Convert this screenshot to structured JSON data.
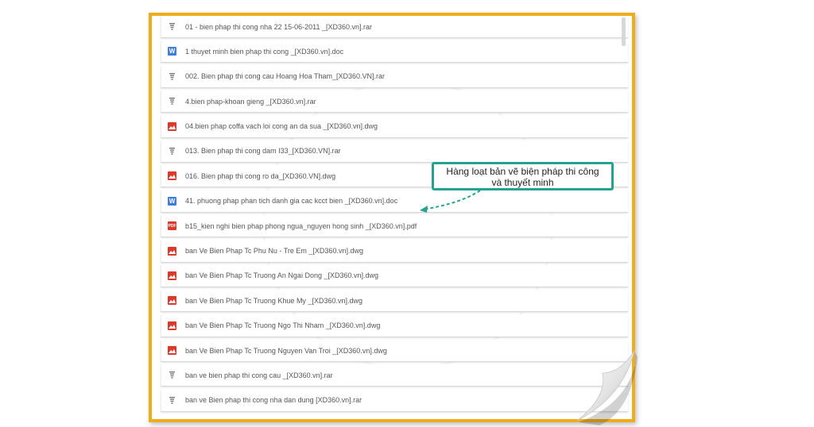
{
  "files": [
    {
      "type": "rar",
      "name": "01 - bien phap thi cong nha 22 15-06-2011 _[XD360.vn].rar"
    },
    {
      "type": "doc",
      "name": "1 thuyet minh bien phap thi cong _[XD360.vn].doc"
    },
    {
      "type": "rar",
      "name": "002. Bien phap thi cong cau Hoang Hoa Tham_[XD360.VN].rar"
    },
    {
      "type": "rar",
      "name": "4.bien phap-khoan gieng _[XD360.vn].rar"
    },
    {
      "type": "dwg",
      "name": "04.bien phap coffa vach loi cong an da sua _[XD360.vn].dwg"
    },
    {
      "type": "rar",
      "name": "013. Bien phap thi cong dam I33_[XD360.VN].rar"
    },
    {
      "type": "dwg",
      "name": "016. Bien phap thi cong ro da_[XD360.VN].dwg"
    },
    {
      "type": "doc",
      "name": "41. phuong phap phan tich danh gia cac kcct bien _[XD360.vn].doc"
    },
    {
      "type": "pdf",
      "name": "b15_kien nghi bien phap phong ngua_nguyen hong sinh _[XD360.vn].pdf"
    },
    {
      "type": "dwg",
      "name": "ban Ve Bien Phap Tc Phu Nu - Tre Em _[XD360.vn].dwg"
    },
    {
      "type": "dwg",
      "name": "ban Ve Bien Phap Tc Truong An Ngai Dong _[XD360.vn].dwg"
    },
    {
      "type": "dwg",
      "name": "ban Ve Bien Phap Tc Truong Khue My _[XD360.vn].dwg"
    },
    {
      "type": "dwg",
      "name": "ban Ve Bien Phap Tc Truong Ngo Thi Nham _[XD360.vn].dwg"
    },
    {
      "type": "dwg",
      "name": "ban Ve Bien Phap Tc Truong Nguyen Van Troi _[XD360.vn].dwg"
    },
    {
      "type": "rar",
      "name": "ban ve bien phap thi cong cau _[XD360.vn].rar"
    },
    {
      "type": "rar",
      "name": "ban ve Bien phap thi cong nha dan dung [XD360.vn].rar"
    }
  ],
  "icons": {
    "rar": "archive-icon",
    "doc": "word-document-icon",
    "dwg": "image-file-icon",
    "pdf": "pdf-file-icon"
  },
  "icon_glyphs": {
    "doc": "W",
    "pdf": "PDF"
  },
  "callout": {
    "line1": "Hàng loạt bản vẽ biện pháp thi công",
    "line2": "và thuyết minh"
  },
  "colors": {
    "frame_border": "#efad1b",
    "callout_border": "#25a292",
    "word_icon": "#3f7ed8",
    "image_icon": "#d93a2b"
  }
}
